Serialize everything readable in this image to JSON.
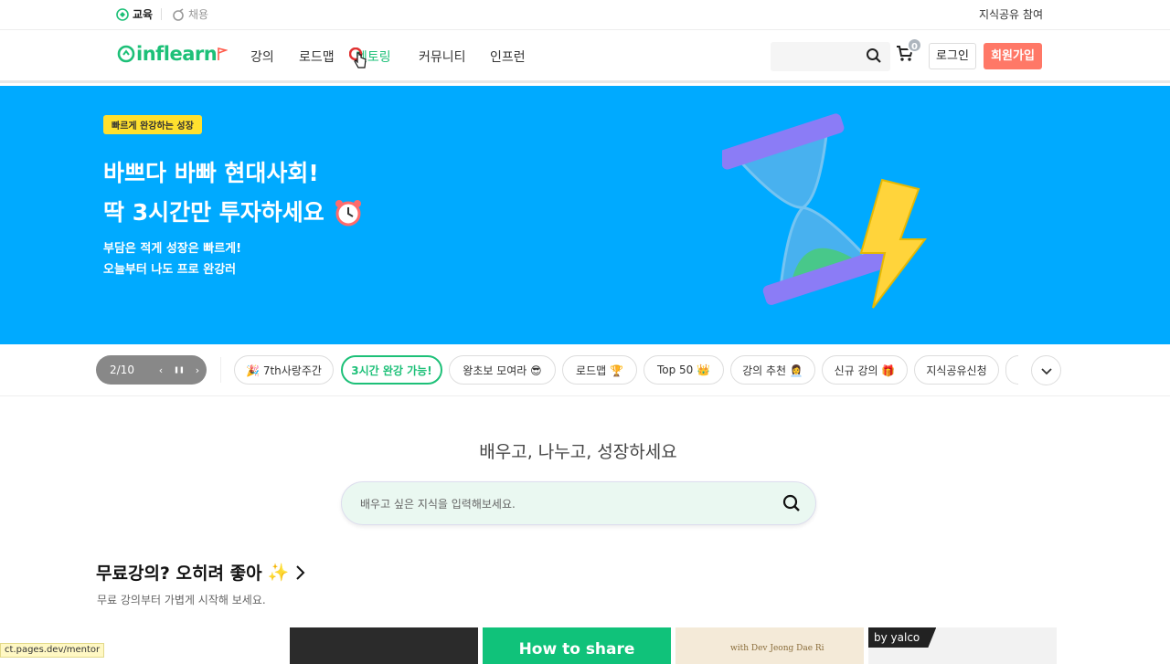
{
  "topbar": {
    "tab_education": "교육",
    "tab_jobs": "채용",
    "share_knowledge": "지식공유 참여"
  },
  "header": {
    "logo_text": "inflearn",
    "nav": [
      "강의",
      "로드맵",
      "멘토링",
      "커뮤니티",
      "인프런"
    ],
    "active_nav": "멘토링",
    "cart_count": "0",
    "login_label": "로그인",
    "signup_label": "회원가입"
  },
  "hero": {
    "badge": "빠르게 완강하는 성장",
    "title_line1": "바쁘다 바빠 현대사회!",
    "title_line2": "딱 3시간만 투자하세요",
    "sub_line1": "부담은 적게 성장은 빠르게!",
    "sub_line2": "오늘부터 나도 프로 완강러",
    "bg_color": "#00aaff"
  },
  "carousel": {
    "page_indicator": "2/10",
    "prev_icon": "‹",
    "pause_icon": "❚❚",
    "next_icon": "›",
    "chips": [
      "🎉 7th사랑주간",
      "3시간 완강 가능!",
      "왕초보 모여라 😎",
      "로드맵 🏆",
      "Top 50 👑",
      "강의 추천 👩‍💼",
      "신규 강의 🎁",
      "지식공유신청"
    ],
    "active_chip_index": 1
  },
  "main": {
    "headline": "배우고, 나누고, 성장하세요",
    "search_placeholder": "배우고 싶은 지식을 입력해보세요."
  },
  "section_free": {
    "title": "무료강의? 오히려 좋아",
    "title_emoji": "✨",
    "subtitle": "무료 강의부터 가볍게 시작해 보세요."
  },
  "cards": {
    "card2_text": "How to share",
    "card3_text": "with Dev Jeong Dae Ri",
    "card4_badge": "by yalco"
  },
  "status_bar": {
    "url": "ct.pages.dev/mentor"
  },
  "colors": {
    "brand_green": "#1dc078",
    "signup_red": "#ff7867"
  }
}
